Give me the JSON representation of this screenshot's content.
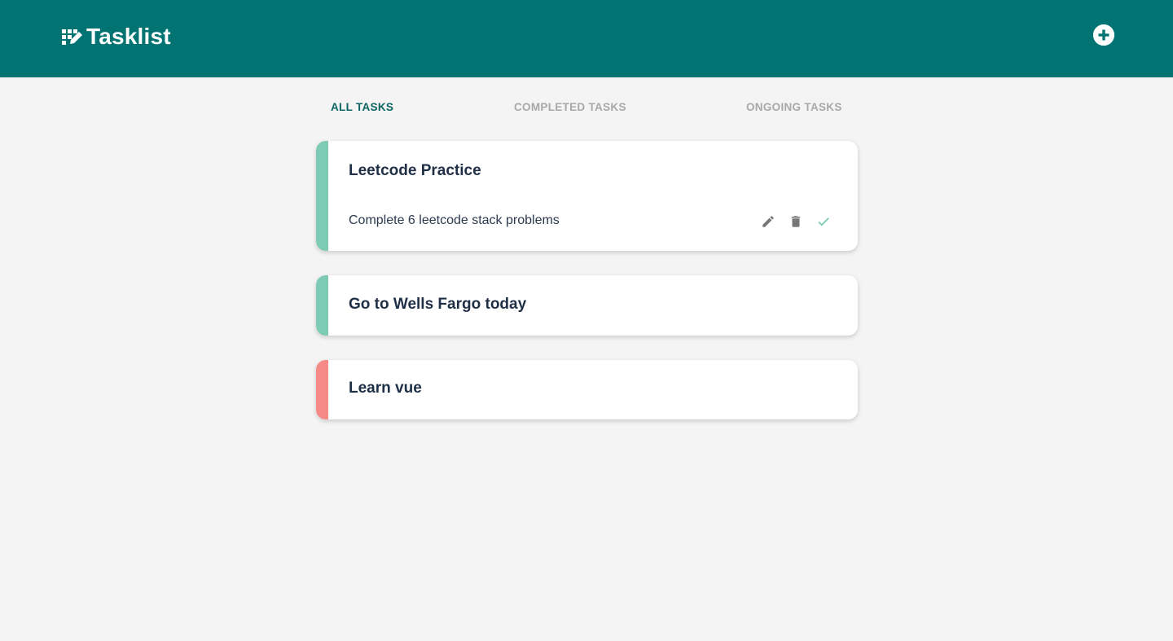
{
  "app": {
    "title": "Tasklist",
    "logo_icon": "tasklist-logo-icon",
    "add_icon": "plus-circle-icon"
  },
  "colors": {
    "header_bg": "#017373",
    "page_bg": "#f4f4f4",
    "active_tab": "#0b6461",
    "inactive_tab": "#a8a8a8",
    "stripe_green": "#7ecbb5",
    "stripe_red": "#f58a86",
    "check_green": "#5fc6a8"
  },
  "tabs": [
    {
      "label": "ALL TASKS",
      "active": true
    },
    {
      "label": "COMPLETED TASKS",
      "active": false
    },
    {
      "label": "ONGOING TASKS",
      "active": false
    }
  ],
  "tasks": [
    {
      "title": "Leetcode Practice",
      "description": "Complete 6 leetcode stack problems",
      "status_color": "#7ecbb5",
      "expanded": true,
      "actions": [
        "pencil-icon",
        "trash-icon",
        "check-icon"
      ]
    },
    {
      "title": "Go to Wells Fargo today",
      "status_color": "#7ecbb5",
      "expanded": false
    },
    {
      "title": "Learn vue",
      "status_color": "#f58a86",
      "expanded": false
    }
  ]
}
